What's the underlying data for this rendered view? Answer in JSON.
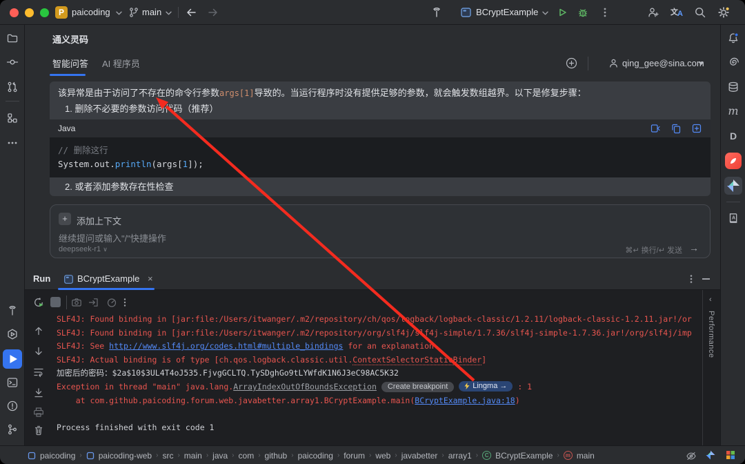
{
  "titlebar": {
    "project": "paicoding",
    "branch": "main",
    "run_config": "BCryptExample"
  },
  "chat": {
    "panel_title": "通义灵码",
    "tab_qa": "智能问答",
    "tab_ai": "AI 程序员",
    "account_email": "qing_gee@sina.com",
    "message": {
      "intro_pre": "该异常是由于访问了不存在的命令行参数",
      "intro_code": "args[1]",
      "intro_post": "导致的。当运行程序时没有提供足够的参数，就会触发数组越界。以下是修复步骤：",
      "step1": "1. 删除不必要的参数访问代码（推荐）",
      "code_lang": "Java",
      "code_comment": "// 删除这行",
      "code_seg1": "System.out.",
      "code_seg2": "println",
      "code_seg3": "(args[",
      "code_seg4": "1",
      "code_seg5": "]);",
      "step2": "2. 或者添加参数存在性检查"
    },
    "input": {
      "add_context": "添加上下文",
      "placeholder": "继续提问或输入\"/\"快捷操作",
      "model": "deepseek-r1",
      "send_hint": "⌘↵ 换行/↵ 发送",
      "send_arrow": "→"
    }
  },
  "run": {
    "panel_label": "Run",
    "tab_title": "BCryptExample",
    "performance_tab": "Performance",
    "console": {
      "l1": "SLF4J: Found binding in [jar:file:/Users/itwanger/.m2/repository/ch/qos/logback/logback-classic/1.2.11/logback-classic-1.2.11.jar!/or",
      "l2": "SLF4J: Found binding in [jar:file:/Users/itwanger/.m2/repository/org/slf4j/slf4j-simple/1.7.36/slf4j-simple-1.7.36.jar!/org/slf4j/imp",
      "l3_pre": "SLF4J: See ",
      "l3_link": "http://www.slf4j.org/codes.html#multiple_bindings",
      "l3_post": " for an explanation.",
      "l4_pre": "SLF4J: Actual binding is of type [ch.qos.logback.classic.util.",
      "l4_ref": "ContextSelectorStaticBinder",
      "l4_post": "]",
      "l5": "加密后的密码：$2a$10$3UL4T4oJ535.FjvgGCLTQ.TySDghGo9tLYWfdK1N6J3eC98AC5K32",
      "l6_pre": "Exception in thread \"main\" java.lang.",
      "l6_exc": "ArrayIndexOutOfBoundsException",
      "l6_badge_breakpoint": "Create breakpoint",
      "l6_badge_lingma": "Lingma →",
      "l6_post": ": 1",
      "l7_pre": "    at com.github.paicoding.forum.web.javabetter.array1.BCryptExample.main(",
      "l7_link": "BCryptExample.java:18",
      "l7_post": ")",
      "l9": "Process finished with exit code 1"
    }
  },
  "statusbar": {
    "crumbs": [
      "paicoding",
      "paicoding-web",
      "src",
      "main",
      "java",
      "com",
      "github",
      "paicoding",
      "forum",
      "web",
      "javabetter",
      "array1",
      "BCryptExample",
      "main"
    ]
  }
}
